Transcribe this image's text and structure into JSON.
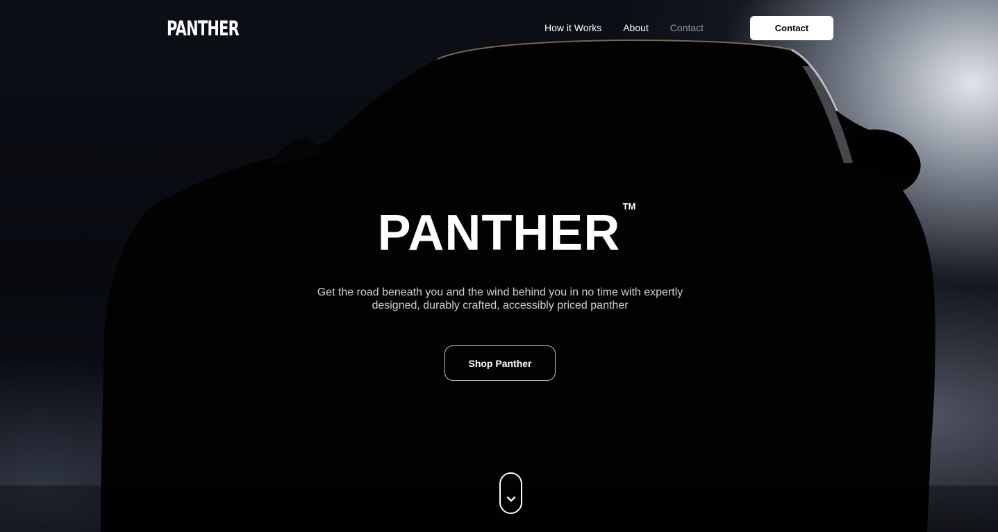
{
  "nav": {
    "logo": "PANTHER",
    "links": [
      "How it Works",
      "About",
      "Contact"
    ],
    "contact_button": "Contact"
  },
  "hero": {
    "title": "PANTHER",
    "trademark": "TM",
    "subtitle_line1": "Get the road beneath you and the wind behind you in no time with expertly",
    "subtitle_line2": "designed, durably crafted, accessibly priced panther",
    "cta": "Shop Panther"
  },
  "icons": {
    "scroll": "chevron-down-icon"
  },
  "colors": {
    "background": "#000000",
    "text": "#ffffff",
    "subtitle": "#cfd0d3",
    "button_bg": "#ffffff",
    "button_text": "#000000"
  }
}
